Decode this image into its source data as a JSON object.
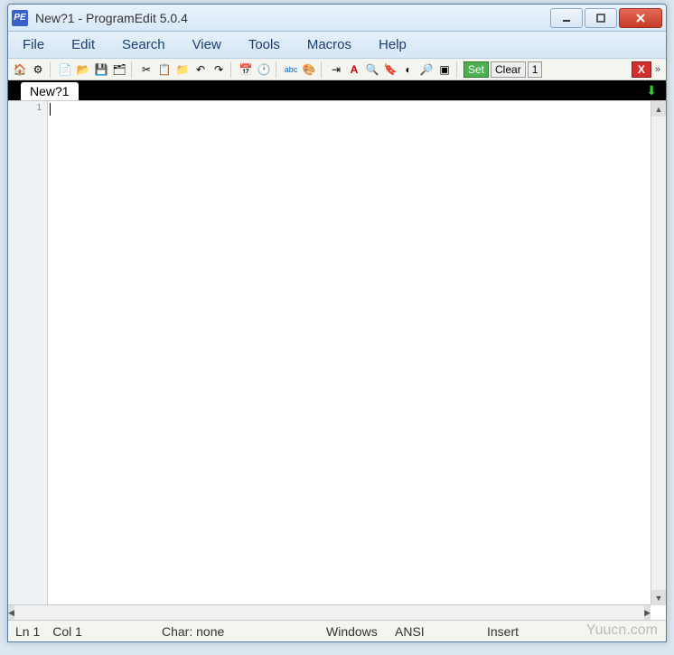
{
  "app_icon_text": "PE",
  "title": "New?1  -  ProgramEdit 5.0.4",
  "menus": [
    "File",
    "Edit",
    "Search",
    "View",
    "Tools",
    "Macros",
    "Help"
  ],
  "toolbar": {
    "set": "Set",
    "clear": "Clear",
    "num": "1",
    "x": "X"
  },
  "tab": {
    "label": "New?1"
  },
  "gutter_line": "1",
  "status": {
    "line": "Ln 1",
    "col": "Col 1",
    "char": "Char: none",
    "os": "Windows",
    "encoding": "ANSI",
    "mode": "Insert"
  },
  "watermark": "Yuucn.com"
}
